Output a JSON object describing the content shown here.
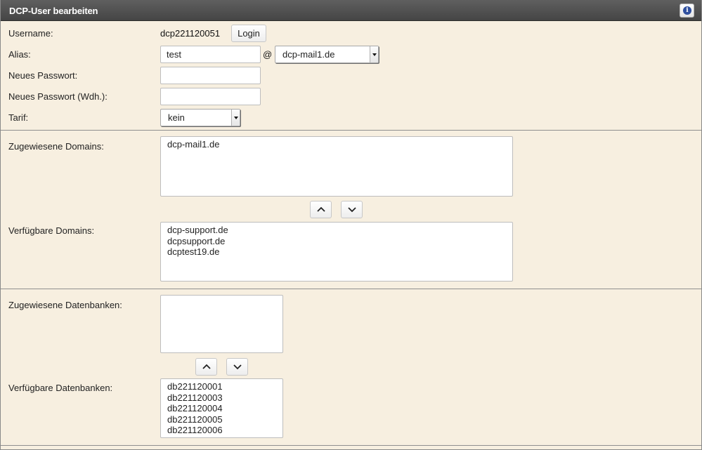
{
  "header": {
    "title": "DCP-User bearbeiten",
    "info_icon": "info-icon"
  },
  "form": {
    "username": {
      "label": "Username:",
      "value": "dcp221120051",
      "login_button": "Login"
    },
    "alias": {
      "label": "Alias:",
      "value": "test",
      "at_sign": "@",
      "domain_selected": "dcp-mail1.de"
    },
    "new_password": {
      "label": "Neues Passwort:",
      "value": ""
    },
    "new_password_repeat": {
      "label": "Neues Passwort (Wdh.):",
      "value": ""
    },
    "tariff": {
      "label": "Tarif:",
      "selected": "kein"
    }
  },
  "domains": {
    "assigned_label": "Zugewiesene Domains:",
    "assigned": [
      "dcp-mail1.de"
    ],
    "available_label": "Verfügbare Domains:",
    "available": [
      "dcp-support.de",
      "dcpsupport.de",
      "dcptest19.de"
    ]
  },
  "databases": {
    "assigned_label": "Zugewiesene Datenbanken:",
    "assigned": [],
    "available_label": "Verfügbare Datenbanken:",
    "available": [
      "db221120001",
      "db221120003",
      "db221120004",
      "db221120005",
      "db221120006"
    ]
  },
  "icons": {
    "move_up": "chevron-up-icon",
    "move_down": "chevron-down-icon"
  }
}
